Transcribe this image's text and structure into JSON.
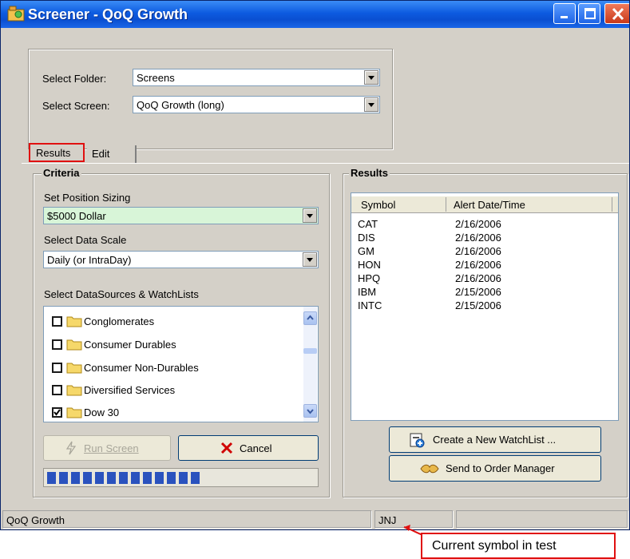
{
  "window": {
    "title": "Screener - QoQ Growth"
  },
  "folder": {
    "label": "Select Folder:",
    "value": "Screens"
  },
  "screen": {
    "label": "Select Screen:",
    "value": "QoQ Growth (long)"
  },
  "tabs": [
    {
      "label": "Results"
    },
    {
      "label": "Edit"
    }
  ],
  "criteria": {
    "title": "Criteria",
    "position_sizing": {
      "label": "Set Position Sizing",
      "value": "$5000 Dollar"
    },
    "data_scale": {
      "label": "Select Data Scale",
      "value": "Daily (or IntraDay)"
    },
    "sources": {
      "label": "Select DataSources & WatchLists",
      "items": [
        {
          "label": "Conglomerates",
          "checked": false
        },
        {
          "label": "Consumer Durables",
          "checked": false
        },
        {
          "label": "Consumer Non-Durables",
          "checked": false
        },
        {
          "label": "Diversified Services",
          "checked": false
        },
        {
          "label": "Dow 30",
          "checked": true
        }
      ]
    },
    "run_label": "Run Screen",
    "cancel_label": "Cancel",
    "progress": {
      "filled_blocks": 13
    }
  },
  "results": {
    "title": "Results",
    "columns": [
      "Symbol",
      "Alert Date/Time"
    ],
    "rows": [
      {
        "symbol": "CAT",
        "date": "2/16/2006"
      },
      {
        "symbol": "DIS",
        "date": "2/16/2006"
      },
      {
        "symbol": "GM",
        "date": "2/16/2006"
      },
      {
        "symbol": "HON",
        "date": "2/16/2006"
      },
      {
        "symbol": "HPQ",
        "date": "2/16/2006"
      },
      {
        "symbol": "IBM",
        "date": "2/15/2006"
      },
      {
        "symbol": "INTC",
        "date": "2/15/2006"
      }
    ],
    "create_watchlist_label": "Create a New WatchList ...",
    "send_order_label": "Send to Order Manager"
  },
  "status": {
    "screen": "QoQ Growth",
    "symbol": "JNJ"
  },
  "callout": {
    "text": "Current symbol in test"
  },
  "colors": {
    "title_bar": "#0a4fd1",
    "highlight": "#e01010",
    "position_sizing_bg": "#d8f5d8",
    "progress": "#2a52be"
  }
}
